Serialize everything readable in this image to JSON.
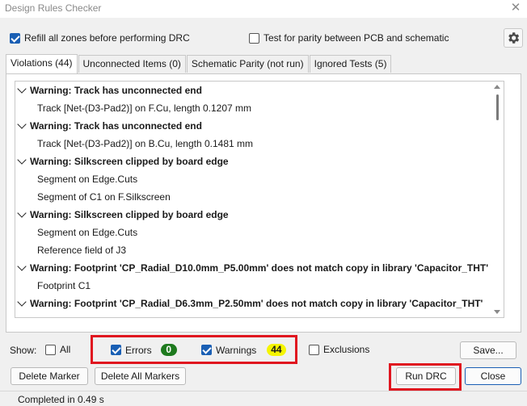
{
  "window": {
    "title": "Design Rules Checker",
    "close_glyph": "✕"
  },
  "options": {
    "refill_zones": {
      "label": "Refill all zones before performing DRC",
      "checked": true
    },
    "parity_test": {
      "label": "Test for parity between PCB and schematic",
      "checked": false
    },
    "settings_icon": "gear-icon"
  },
  "tabs": [
    {
      "label": "Violations (44)",
      "active": true
    },
    {
      "label": "Unconnected Items (0)",
      "active": false
    },
    {
      "label": "Schematic Parity (not run)",
      "active": false
    },
    {
      "label": "Ignored Tests (5)",
      "active": false
    }
  ],
  "violations": [
    {
      "type": "warning",
      "text": "Warning: Track has unconnected end"
    },
    {
      "type": "item",
      "text": "Track [Net-(D3-Pad2)] on F.Cu, length 0.1207 mm"
    },
    {
      "type": "warning",
      "text": "Warning: Track has unconnected end"
    },
    {
      "type": "item",
      "text": "Track [Net-(D3-Pad2)] on B.Cu, length 0.1481 mm"
    },
    {
      "type": "warning",
      "text": "Warning: Silkscreen clipped by board edge"
    },
    {
      "type": "item",
      "text": "Segment on Edge.Cuts"
    },
    {
      "type": "item",
      "text": "Segment of C1 on F.Silkscreen"
    },
    {
      "type": "warning",
      "text": "Warning: Silkscreen clipped by board edge"
    },
    {
      "type": "item",
      "text": "Segment on Edge.Cuts"
    },
    {
      "type": "item",
      "text": "Reference field of J3"
    },
    {
      "type": "warning",
      "text": "Warning: Footprint 'CP_Radial_D10.0mm_P5.00mm' does not match copy in library 'Capacitor_THT'"
    },
    {
      "type": "item",
      "text": "Footprint C1"
    },
    {
      "type": "warning",
      "text": "Warning: Footprint 'CP_Radial_D6.3mm_P2.50mm' does not match copy in library 'Capacitor_THT'"
    }
  ],
  "filters": {
    "show_label": "Show:",
    "all": {
      "label": "All",
      "checked": false
    },
    "errors": {
      "label": "Errors",
      "checked": true,
      "count": "0"
    },
    "warnings": {
      "label": "Warnings",
      "checked": true,
      "count": "44"
    },
    "exclusions": {
      "label": "Exclusions",
      "checked": false
    }
  },
  "buttons": {
    "save": "Save...",
    "delete_marker": "Delete Marker",
    "delete_all_markers": "Delete All Markers",
    "run_drc": "Run DRC",
    "close": "Close"
  },
  "status": {
    "text": "Completed in 0.49 s"
  },
  "colors": {
    "highlight": "#e0151f",
    "errors_badge": "#1e7a1e",
    "warnings_badge": "#f5f500",
    "accent": "#1a5fb4"
  }
}
